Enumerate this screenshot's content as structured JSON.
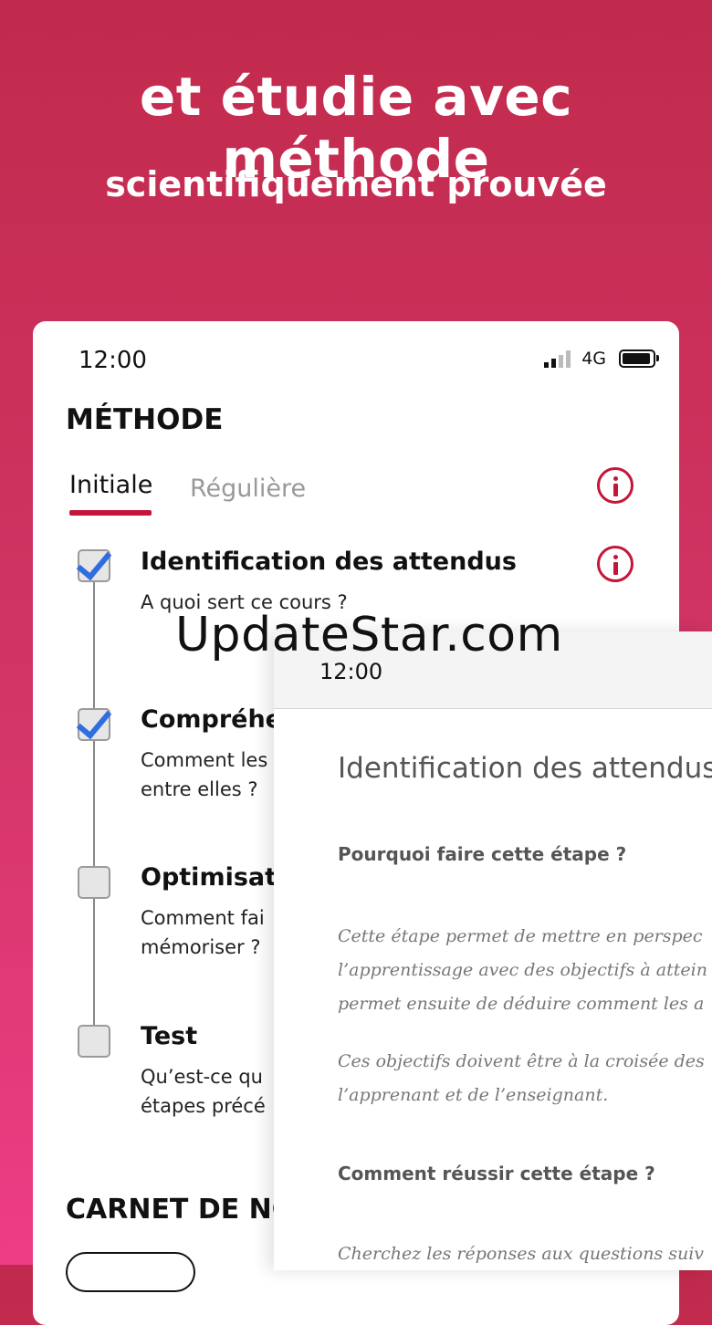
{
  "hero": {
    "title": "et étudie avec méthode",
    "subtitle": "scientifiquement prouvée"
  },
  "phone_main": {
    "status": {
      "time": "12:00",
      "network": "4G"
    },
    "section_title": "MÉTHODE",
    "tabs": [
      {
        "label": "Initiale",
        "active": true
      },
      {
        "label": "Régulière",
        "active": false
      }
    ],
    "steps": [
      {
        "title": "Identification des attendus",
        "lines": [
          "A quoi sert ce cours ?"
        ],
        "checked": true
      },
      {
        "title": "Compréhe",
        "lines": [
          "Comment les",
          "entre elles ?"
        ],
        "checked": true
      },
      {
        "title": "Optimisati",
        "lines": [
          "Comment fai",
          "mémoriser ?"
        ],
        "checked": false
      },
      {
        "title": "Test",
        "lines": [
          "Qu’est-ce qu",
          "étapes précé"
        ],
        "checked": false
      }
    ],
    "notebook_title": "CARNET DE NO"
  },
  "watermark": "UpdateStar.com",
  "phone_detail": {
    "status": {
      "time": "12:00"
    },
    "title": "Identification des attendus",
    "question1": "Pourquoi faire cette étape ?",
    "paragraph1": [
      "Cette étape permet de mettre en perspec",
      "l’apprentissage avec des objectifs à attein",
      "permet ensuite de déduire comment les a"
    ],
    "paragraph2": [
      "Ces objectifs doivent être à la croisée des",
      "l’apprenant et de l’enseignant."
    ],
    "question2": "Comment réussir cette étape ?",
    "paragraph3": [
      "Cherchez les réponses aux questions suiv"
    ]
  },
  "colors": {
    "background_top": "#c12a4c",
    "background_bottom": "#ee3d86",
    "accent": "#c4163b",
    "check": "#2f6ee0"
  }
}
